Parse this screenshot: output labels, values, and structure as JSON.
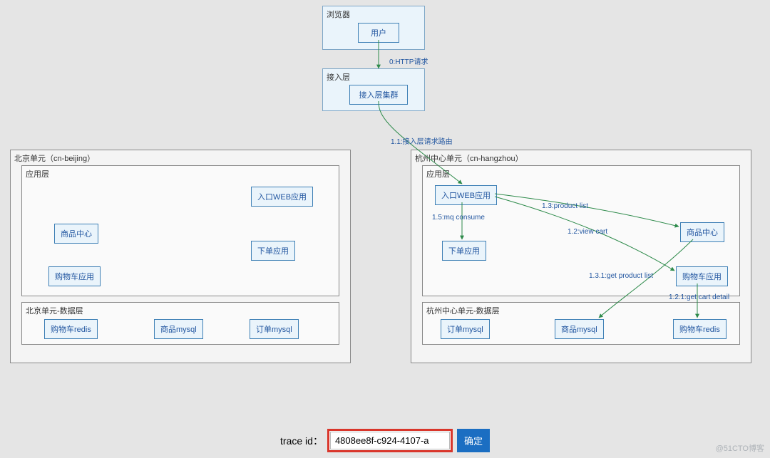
{
  "groups": {
    "browser": {
      "label": "浏览器"
    },
    "access": {
      "label": "接入层"
    },
    "beijing": {
      "label": "北京单元（cn-beijing）"
    },
    "beijing_app": {
      "label": "应用层"
    },
    "beijing_data": {
      "label": "北京单元-数据层"
    },
    "hangzhou": {
      "label": "杭州中心单元（cn-hangzhou）"
    },
    "hangzhou_app": {
      "label": "应用层"
    },
    "hangzhou_data": {
      "label": "杭州中心单元-数据层"
    }
  },
  "nodes": {
    "user": "用户",
    "access_cluster": "接入层集群",
    "bj_web": "入口WEB应用",
    "bj_product": "商品中心",
    "bj_order": "下单应用",
    "bj_cart": "购物车应用",
    "bj_cart_redis": "购物车redis",
    "bj_product_mysql": "商品mysql",
    "bj_order_mysql": "订单mysql",
    "hz_web": "入口WEB应用",
    "hz_product": "商品中心",
    "hz_order": "下单应用",
    "hz_cart": "购物车应用",
    "hz_cart_redis": "购物车redis",
    "hz_product_mysql": "商品mysql",
    "hz_order_mysql": "订单mysql"
  },
  "edges": {
    "e0": "0:HTTP请求",
    "e11": "1.1:接入层请求路由",
    "e12": "1.2:view cart",
    "e13": "1.3:product list",
    "e15": "1.5:mq consume",
    "e131": "1.3.1:get product list",
    "e121": "1.2.1:get cart detail"
  },
  "footer": {
    "label": "trace id：",
    "value": "4808ee8f-c924-4107-a",
    "button": "确定"
  },
  "watermark": "@51CTO博客"
}
